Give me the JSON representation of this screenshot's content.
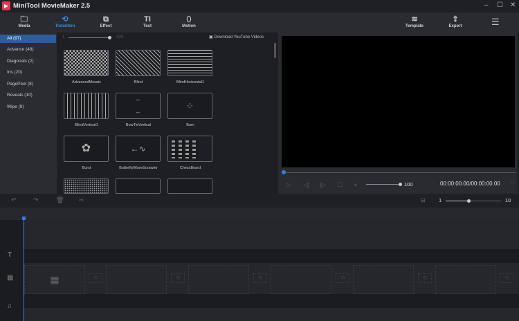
{
  "app": {
    "title": "MiniTool MovieMaker 2.5"
  },
  "toolbar": {
    "items": [
      {
        "label": "Media",
        "icon": "folder-icon"
      },
      {
        "label": "Transition",
        "icon": "transition-icon",
        "active": true
      },
      {
        "label": "Effect",
        "icon": "effect-icon"
      },
      {
        "label": "Text",
        "icon": "text-icon"
      },
      {
        "label": "Motion",
        "icon": "motion-icon"
      }
    ],
    "template": "Template",
    "export": "Export"
  },
  "sidebar": {
    "items": [
      {
        "label": "All (97)",
        "selected": true
      },
      {
        "label": "Advance (48)"
      },
      {
        "label": "Diagonals (2)"
      },
      {
        "label": "Iris (20)"
      },
      {
        "label": "PagePeel (8)"
      },
      {
        "label": "Reveals (10)"
      },
      {
        "label": "Wipe (9)"
      }
    ]
  },
  "browser": {
    "size_min": "1",
    "size_max": "100",
    "download": "Download YouTube Videos",
    "transitions": [
      "AdvancedMosaic",
      "Blind",
      "BlindHorizontal1",
      "BlindVertical1",
      "BowTieVertical",
      "Burn",
      "Burst",
      "ButterflyWaveScrawler",
      "ChessBoard"
    ]
  },
  "player": {
    "volume": "100",
    "time": "00:00:00.00/00:00:00.00",
    "progress": 0
  },
  "timeline": {
    "zoom_min": "1",
    "zoom_max": "10",
    "accent": "#2f7fe0"
  }
}
